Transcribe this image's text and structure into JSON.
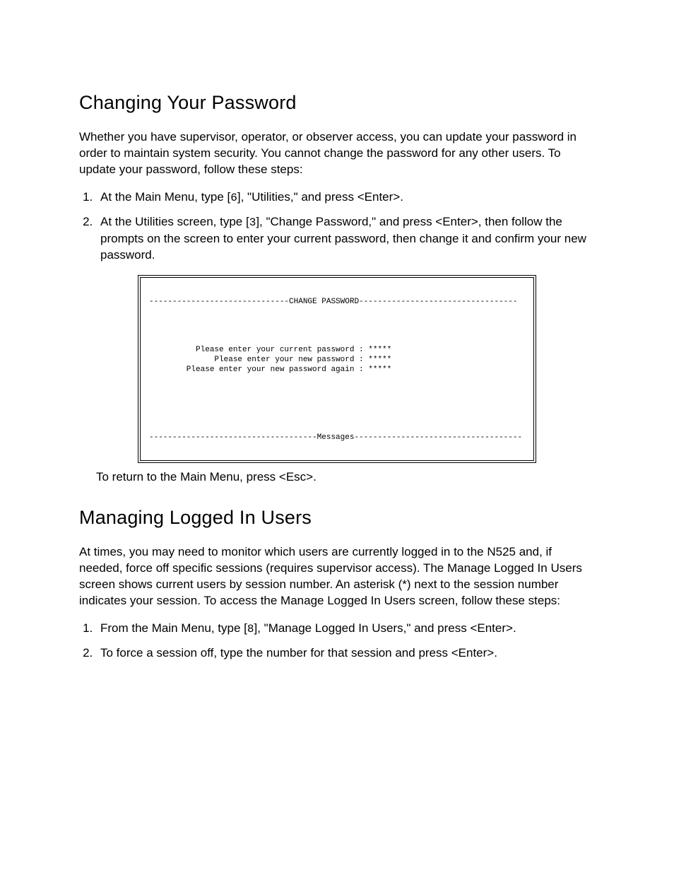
{
  "section1": {
    "heading": "Changing Your Password",
    "intro": "Whether you have supervisor, operator, or observer access, you can update your password in order to maintain system security. You cannot change the password for any other users. To update your password, follow these steps:",
    "step1_pre": "At the Main Menu, type [",
    "step1_key": "6",
    "step1_post": "], \"Utilities,\" and press <Enter>.",
    "step2_pre": "At the Utilities screen, type [",
    "step2_key": "3",
    "step2_post": "], \"Change Password,\" and press <Enter>, then follow the prompts on the screen to enter your current password, then change it and confirm your new password.",
    "return_line": "To return to the Main Menu, press <Esc>."
  },
  "terminal1": {
    "header_line": "------------------------------CHANGE PASSWORD----------------------------------",
    "prompt1": "          Please enter your current password : *****",
    "prompt2": "              Please enter your new password : *****",
    "prompt3": "        Please enter your new password again : *****",
    "messages_line": "------------------------------------Messages------------------------------------"
  },
  "section2": {
    "heading": "Managing Logged In Users",
    "intro": "At times, you may need to monitor which users are currently logged in to the N525 and, if needed, force off specific sessions (requires supervisor access). The Manage Logged In Users screen shows current users by session number. An asterisk (*) next to the session number indicates your session. To access the Manage Logged In Users screen, follow these steps:",
    "step1_pre": "From the Main Menu, type [",
    "step1_key": "8",
    "step1_post": "], \"Manage Logged In Users,\" and press <Enter>.",
    "step2": "To force a session off, type the number for that session and press <Enter>."
  }
}
